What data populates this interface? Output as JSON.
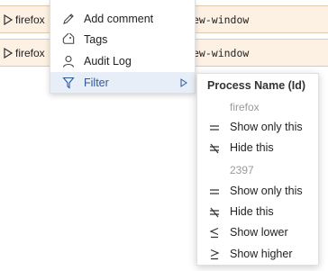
{
  "rows": [
    {
      "process": "firefox",
      "command": "ew-window"
    },
    {
      "process": "firefox",
      "command": "ew-window"
    }
  ],
  "context_menu": {
    "items": [
      {
        "label": "Add comment",
        "icon": "pencil-icon"
      },
      {
        "label": "Tags",
        "icon": "tag-icon"
      },
      {
        "label": "Audit Log",
        "icon": "person-icon"
      },
      {
        "label": "Filter",
        "icon": "filter-icon",
        "has_submenu": true
      }
    ]
  },
  "filter_submenu": {
    "header": "Process Name (Id)",
    "group1": {
      "value": "firefox",
      "show_only": "Show only this",
      "hide": "Hide this"
    },
    "group2": {
      "value": "2397",
      "show_only": "Show only this",
      "hide": "Hide this",
      "show_lower": "Show lower",
      "show_higher": "Show higher"
    }
  },
  "colors": {
    "row_bg": "#fdf1e3",
    "accent": "#2a5b9a",
    "muted_text": "#9a9a9a"
  }
}
